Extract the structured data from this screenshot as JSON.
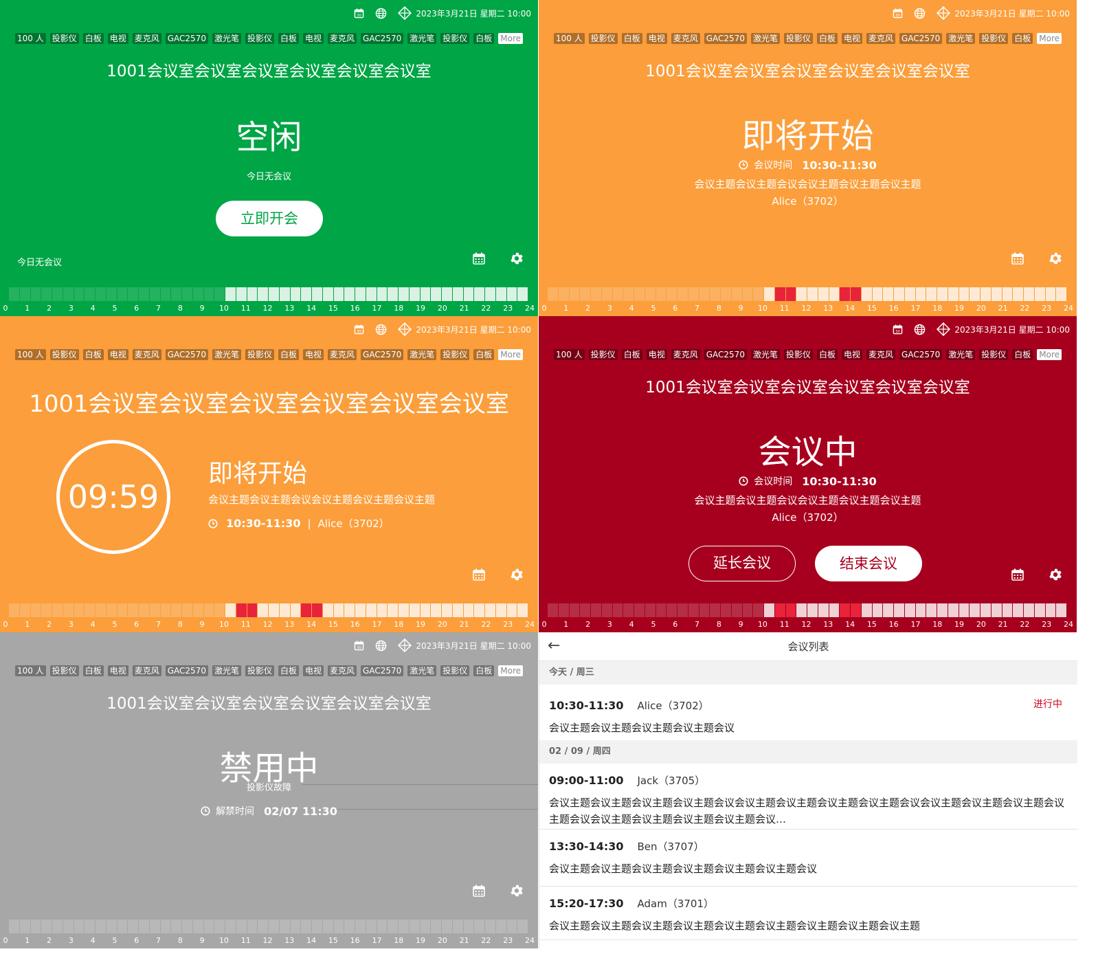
{
  "header": {
    "datetime": "2023年3月21日 星期二 10:00",
    "icons": [
      "calendar-badge-icon",
      "globe-icon",
      "diamond-icon"
    ]
  },
  "tags": [
    "100 人",
    "投影仪",
    "白板",
    "电视",
    "麦克风",
    "GAC2570",
    "激光笔",
    "投影仪",
    "白板",
    "电视",
    "麦克风",
    "GAC2570",
    "激光笔",
    "投影仪",
    "白板"
  ],
  "tags_more": "More",
  "room_name": "1001会议室会议室会议室会议室会议室会议室",
  "ticks": [
    "0",
    "1",
    "2",
    "3",
    "4",
    "5",
    "6",
    "7",
    "8",
    "9",
    "10",
    "11",
    "12",
    "13",
    "14",
    "15",
    "16",
    "17",
    "18",
    "19",
    "20",
    "21",
    "22",
    "23",
    "24"
  ],
  "idle": {
    "status": "空闲",
    "subtitle": "今日无会议",
    "button": "立即开会",
    "bottom_note": "今日无会议"
  },
  "upcoming": {
    "status": "即将开始",
    "time_label": "会议时间",
    "time": "10:30-11:30",
    "topic": "会议主题会议主题会议会议主题会议主题会议主题",
    "host": "Alice（3702）"
  },
  "countdown": {
    "timer": "09:59",
    "status": "即将开始",
    "topic": "会议主题会议主题会议会议主题会议主题会议主题",
    "time": "10:30-11:30",
    "sep": "|",
    "host": "Alice（3702）"
  },
  "in_meeting": {
    "status": "会议中",
    "time_label": "会议时间",
    "time": "10:30-11:30",
    "topic": "会议主题会议主题会议会议主题会议主题会议主题",
    "host": "Alice（3702）",
    "extend_button": "延长会议",
    "end_button": "结束会议"
  },
  "disabled": {
    "status": "禁用中",
    "reason": "投影仪故障",
    "unban_label": "解禁时间",
    "unban_time": "02/07 11:30"
  },
  "meeting_list": {
    "title": "会议列表",
    "back": "←",
    "groups": [
      {
        "day": "今天 / 周三",
        "items": [
          {
            "time": "10:30-11:30",
            "host": "Alice（3702）",
            "topic": "会议主题会议主题会议主题会议主题会议",
            "badge": "进行中"
          }
        ]
      },
      {
        "day": "02 / 09 / 周四",
        "items": [
          {
            "time": "09:00-11:00",
            "host": "Jack（3705）",
            "topic": "会议主题会议主题会议主题会议主题会议会议主题会议主题会议主题会议主题会议会议主题会议主题会议主题会议主题会议会议主题会议主题会议主题会议主题会议…",
            "badge": ""
          },
          {
            "time": "13:30-14:30",
            "host": "Ben（3707）",
            "topic": "会议主题会议主题会议主题会议主题会议主题会议主题会议",
            "badge": ""
          },
          {
            "time": "15:20-17:30",
            "host": "Adam（3701）",
            "topic": "会议主题会议主题会议主题会议主题会议主题会议主题会议主题会议主题会议主题",
            "badge": ""
          }
        ]
      }
    ]
  },
  "colors": {
    "green": "#00a546",
    "orange": "#fb9e3b",
    "red": "#a6001e",
    "gray": "#a7a7a7",
    "booked": "#e8233a"
  }
}
